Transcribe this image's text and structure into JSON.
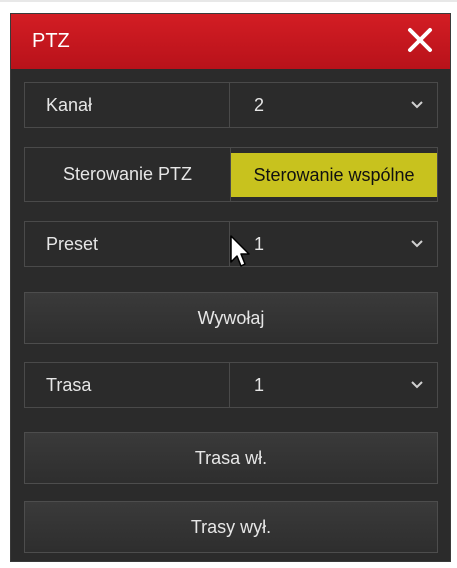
{
  "window": {
    "title": "PTZ"
  },
  "channel": {
    "label": "Kanał",
    "value": "2"
  },
  "control_mode": {
    "ptz_label": "Sterowanie PTZ",
    "common_label": "Sterowanie wspólne",
    "active": "common"
  },
  "preset": {
    "label": "Preset",
    "value": "1",
    "call_button": "Wywołaj"
  },
  "tour": {
    "label": "Trasa",
    "value": "1",
    "on_button": "Trasa wł.",
    "off_button": "Trasy wył."
  },
  "colors": {
    "titlebar": "#c8161d",
    "active_tab": "#c8c21e",
    "panel": "#2b2b2b"
  },
  "icons": {
    "close": "close-icon",
    "dropdown": "chevron-down-icon",
    "pointer": "mouse-cursor-icon"
  }
}
